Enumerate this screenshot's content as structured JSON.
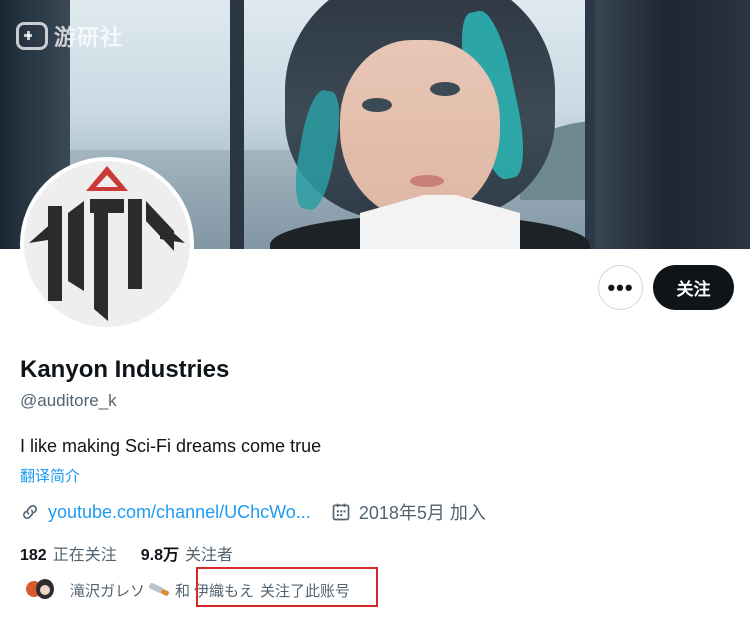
{
  "watermark": {
    "text": "游研社",
    "icon": "gamepad-icon"
  },
  "profile": {
    "name": "Kanyon Industries",
    "handle": "@auditore_k",
    "bio": "I like making Sci-Fi dreams come true",
    "translate_label": "翻译简介",
    "website": "youtube.com/channel/UChcWo...",
    "joined": "2018年5月 加入"
  },
  "actions": {
    "more_label": "•••",
    "follow_label": "关注"
  },
  "stats": {
    "following_count": "182",
    "following_label": "正在关注",
    "followers_count": "9.8万",
    "followers_label": "关注者"
  },
  "followed_by": {
    "user1": "滝沢ガレソ",
    "joiner": "和",
    "user2": "伊織もえ",
    "suffix": "关注了此账号"
  },
  "colors": {
    "accent": "#1d9bf0",
    "text_primary": "#0f1419",
    "text_secondary": "#536471",
    "highlight_box": "#d42a2a"
  }
}
